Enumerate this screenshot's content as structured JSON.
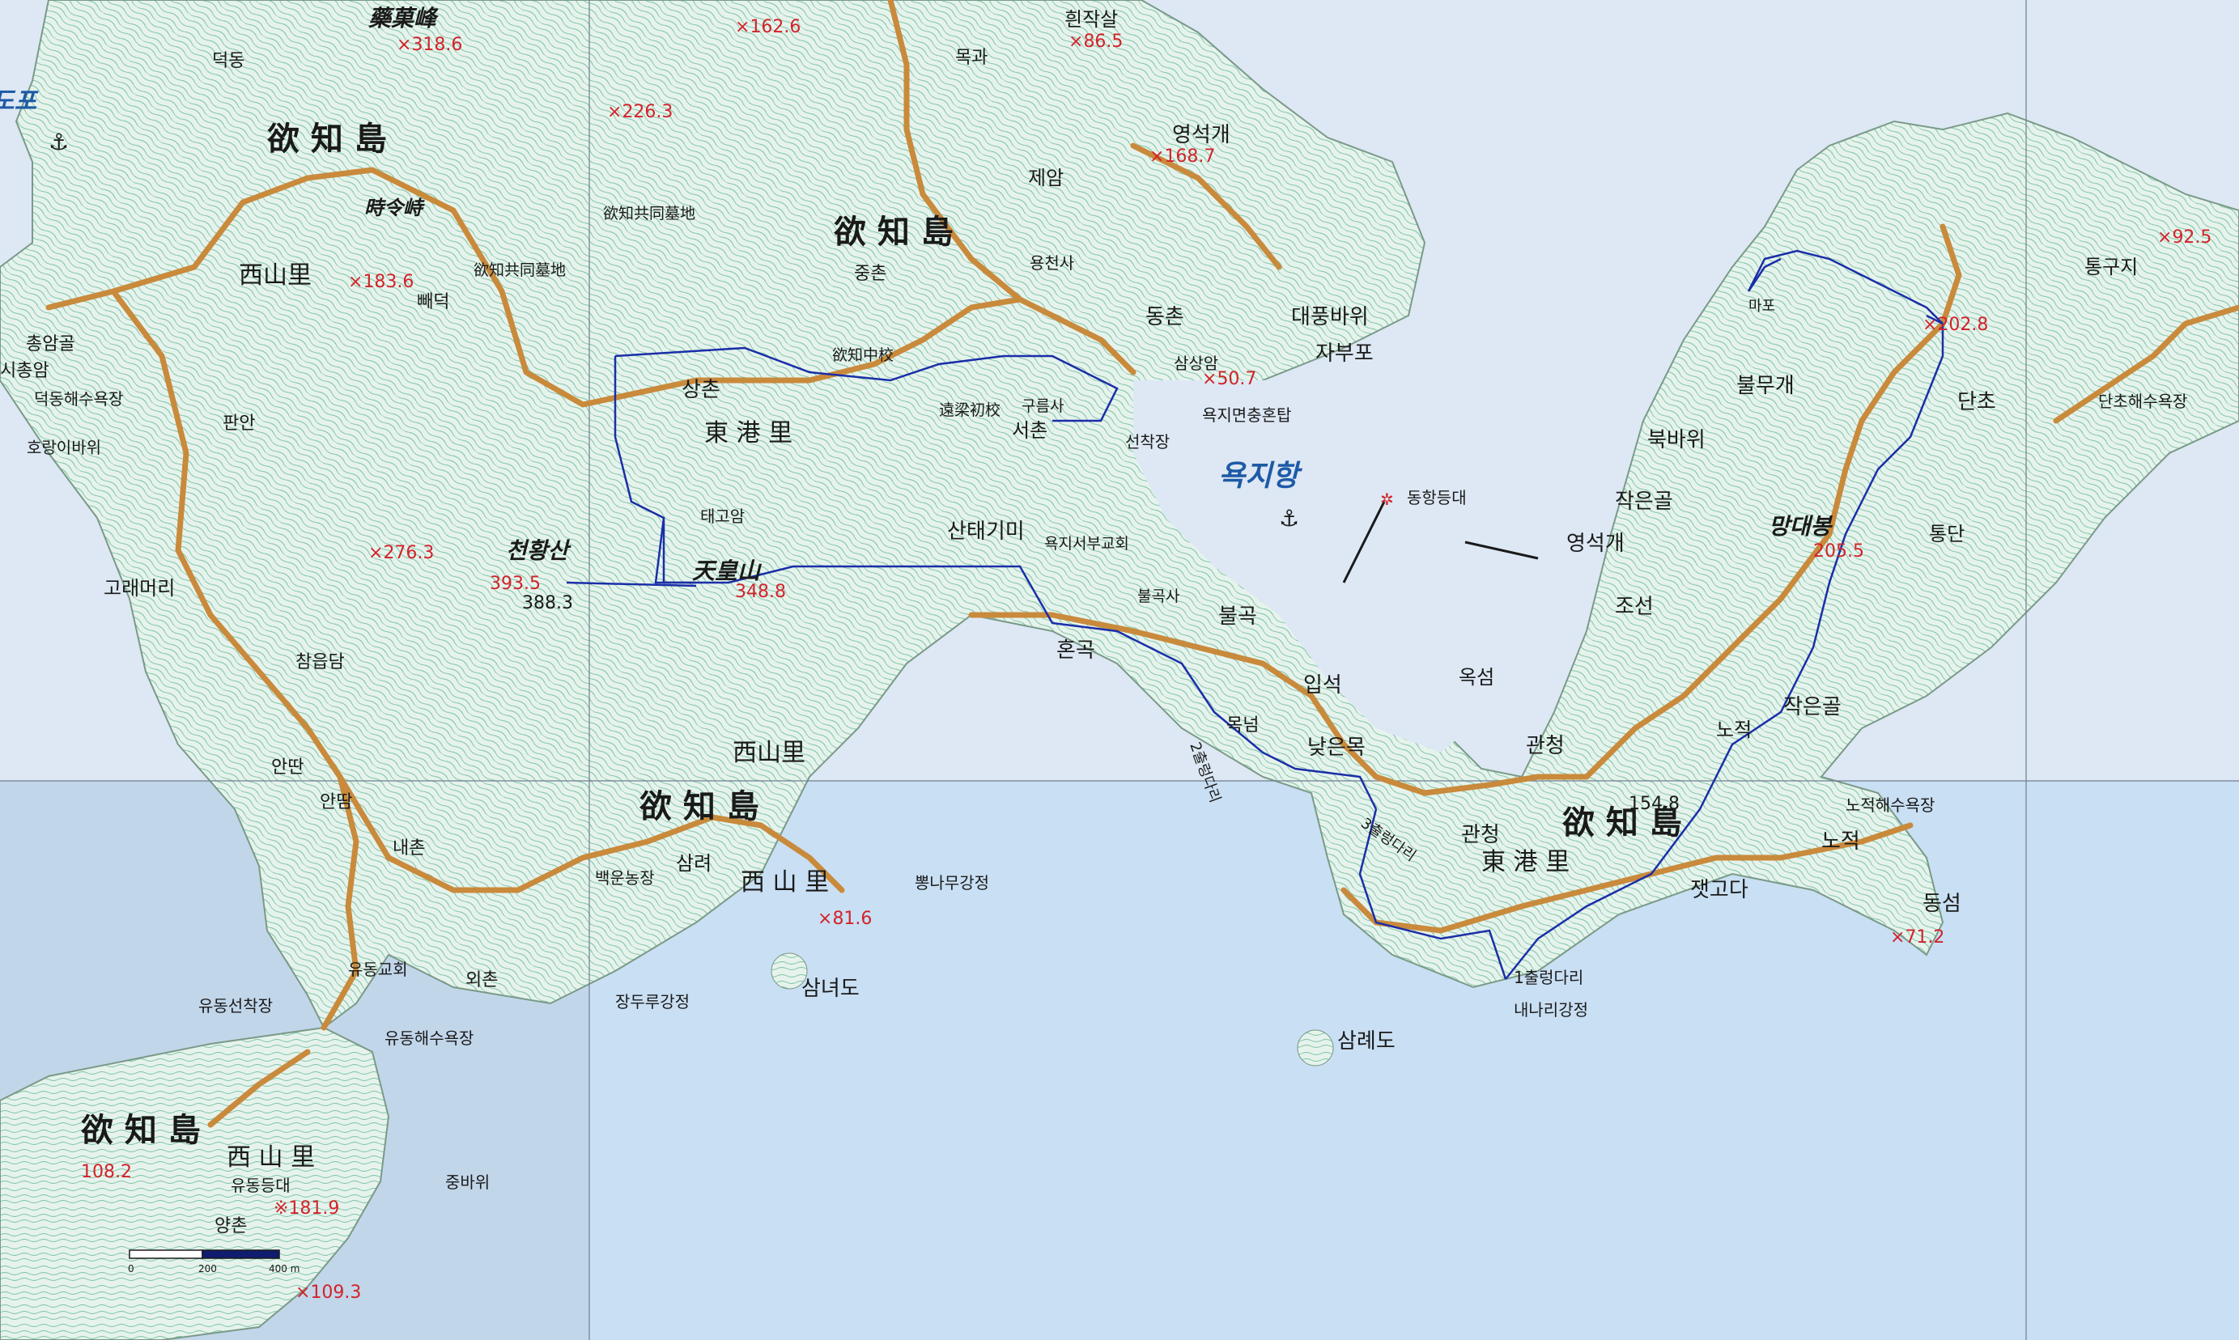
{
  "colors": {
    "sea": "#d9e7f5",
    "sea_south": "#c7def3",
    "land": "#e6f3ec",
    "contour": "#3fa07a",
    "road": "#c98a3c",
    "trail": "#1a2ea8",
    "peak_red": "#d2232a",
    "text": "#1a1a1a",
    "water_label": "#1e5aa6"
  },
  "water_labels": {
    "harbor": "욕지항",
    "west_bay": "도포"
  },
  "big_labels": {
    "n1": "欲 知 島",
    "n2": "欲 知 島",
    "center": "欲 知 島",
    "east": "欲 知 島",
    "sw": "欲 知 島",
    "westmid": "西山里",
    "center_sub": "西山里",
    "south": "西 山 里",
    "sw_sub": "西 山 里",
    "east_sub": "東 港 里",
    "dong1": "東 港 里"
  },
  "peaks": {
    "yak": {
      "name": "藥菓峰",
      "elev": "318.6"
    },
    "chw": {
      "name": "천황산",
      "elev": "393.5",
      "alt": "388.3"
    },
    "tc": {
      "name": "天皇山",
      "elev": "348.8"
    },
    "md": {
      "name": "망대봉",
      "elev": "205.5"
    },
    "p1626": {
      "elev": "162.6"
    },
    "p865": {
      "elev": "86.5"
    },
    "p2263": {
      "elev": "226.3"
    },
    "p1687": {
      "elev": "168.7"
    },
    "p1836": {
      "elev": "183.6"
    },
    "p2763": {
      "elev": "276.3"
    },
    "p507": {
      "elev": "50.7"
    },
    "p2028": {
      "elev": "202.8"
    },
    "p925": {
      "elev": "92.5"
    },
    "p1548": {
      "elev": "154.8"
    },
    "p712": {
      "elev": "71.2"
    },
    "p816": {
      "elev": "81.6"
    },
    "p1082": {
      "elev": "108.2"
    },
    "p1819": {
      "elev": "181.9"
    },
    "p1093": {
      "elev": "109.3"
    }
  },
  "places": {
    "deokdong": "덕동",
    "mokgwa": "목과",
    "heunjak": "흰작살",
    "jeam": "제암",
    "yeongseok1": "영석개",
    "sikryeong": "時令峙",
    "gongmyo1": "欲知共同墓地",
    "gongmyo2": "欲知共同墓地",
    "ppaedeok": "빼덕",
    "jungchon": "중촌",
    "yongcheon": "용천사",
    "dongchon": "동촌",
    "daepung": "대풍바위",
    "jabupo": "자부포",
    "samsan": "삼상암",
    "jonghon": "욕지면충혼탑",
    "jongam": "총암골",
    "sijongam": "시총암",
    "deokdongbeach": "덕동해수욕장",
    "horang": "호랑이바위",
    "panan": "판안",
    "sangchon": "상촌",
    "taegoam": "태고암",
    "middle": "欲知中校",
    "chogyo": "遠梁初校",
    "gureungsa": "구름사",
    "seochon": "서촌",
    "seonchak": "선착장",
    "sanaegimi": "산태기미",
    "church": "욕지서부교회",
    "dongtower": "동항등대",
    "gorae": "고래머리",
    "chamut": "참읍담",
    "bulgoksa": "불곡사",
    "bulgok": "불곡",
    "honggok": "혼곡",
    "ipseok": "입석",
    "okseom": "옥섬",
    "mongnam": "목넘",
    "naeunmok": "낮은목",
    "outbridge": "출렁다리",
    "andam1": "안딴",
    "andam2": "안땀",
    "naechon": "내촌",
    "baekun": "백운농장",
    "samnyeo": "삼려",
    "ppong": "뽕나무강정",
    "yudongchurch": "유동교회",
    "yudongpier": "유동선착장",
    "oechon": "외촌",
    "yudongbeach": "유동해수욕장",
    "samnyeodo": "삼녀도",
    "jangdu": "장두루강정",
    "samnyedo": "삼례도",
    "yudongdeungdae": "유동등대",
    "jungbawi": "중바위",
    "yangchon": "양촌",
    "tonggu": "통구지",
    "dancho": "단초",
    "danchobeach": "단초해수욕장",
    "tongdan": "통단",
    "mapo": "마포",
    "bulmu": "불무개",
    "bukbawi": "북바위",
    "jageun": "작은골",
    "yeongseok2": "영석개",
    "joseon": "조선",
    "jageun2": "작은골",
    "nojeok": "노적",
    "gwancheong1": "관청",
    "gwancheong2": "관청",
    "nojeokbeach": "노적해수욕장",
    "nojeok2": "노적",
    "jaetgoda": "잿고다",
    "dongseom": "동섬",
    "chul1": "1출렁다리",
    "nanari": "내나리강정",
    "chul2": "3출렁다리",
    "chul3": "2출렁다리"
  },
  "scale": {
    "t0": "0",
    "t200": "200",
    "t400": "400 m"
  }
}
